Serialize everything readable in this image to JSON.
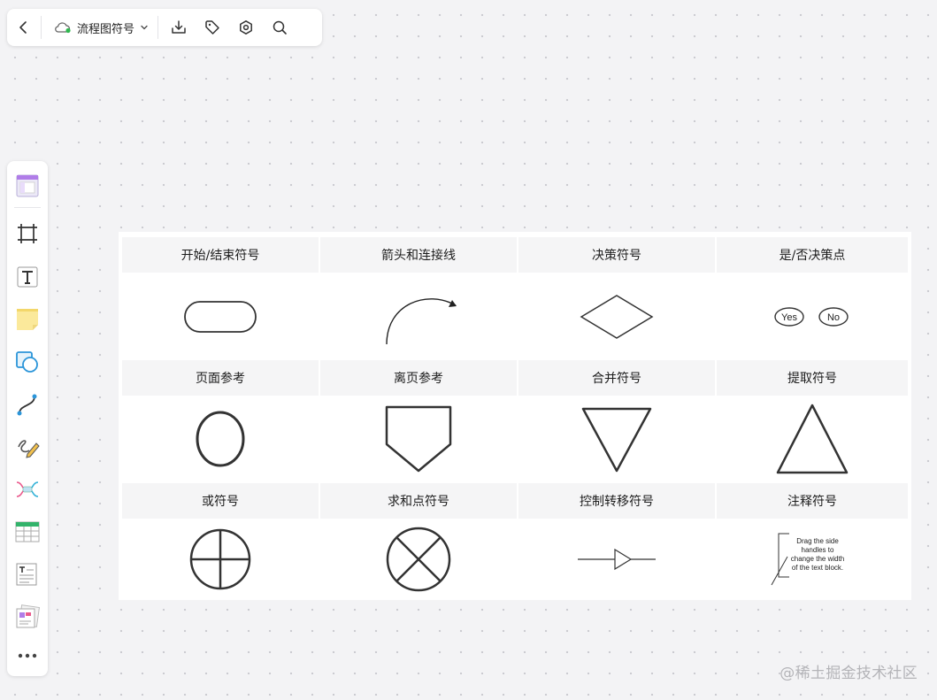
{
  "toolbar": {
    "doc_title": "流程图符号",
    "icons": [
      "back-icon",
      "cloud-sync-icon",
      "chevron-down-icon",
      "download-icon",
      "tag-icon",
      "settings-icon",
      "search-icon"
    ],
    "sync_color": "#2fb84f"
  },
  "sidebar": {
    "tools": [
      "template-icon",
      "frame-icon",
      "text-tool-icon",
      "sticky-note-icon",
      "shape-icon",
      "connector-icon",
      "pen-icon",
      "mind-map-icon",
      "table-icon",
      "text-card-icon",
      "sticker-icon",
      "more-icon"
    ]
  },
  "sheet": {
    "headers": [
      "开始/结束符号",
      "箭头和连接线",
      "决策符号",
      "是/否决策点",
      "页面参考",
      "离页参考",
      "合并符号",
      "提取符号",
      "或符号",
      "求和点符号",
      "控制转移符号",
      "注释符号"
    ],
    "yes_label": "Yes",
    "no_label": "No",
    "annotation_text": [
      "Drag the side",
      "handles to",
      "change the width",
      "of the text block."
    ]
  },
  "watermark": "@稀土掘金技术社区"
}
